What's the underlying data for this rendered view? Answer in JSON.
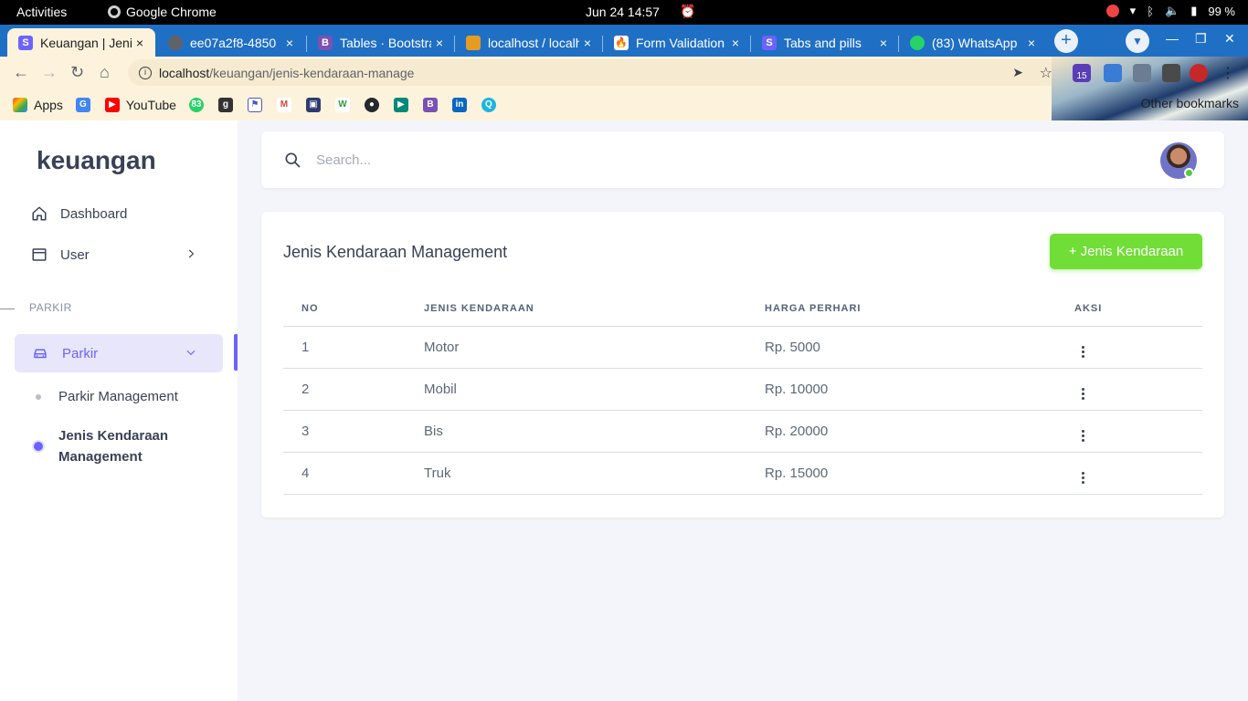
{
  "system": {
    "activities": "Activities",
    "app_name": "Google Chrome",
    "clock": "Jun 24  14:57",
    "battery": "99 %"
  },
  "browser": {
    "tabs": [
      {
        "title": "Keuangan | Jenis",
        "favicon_color": "#6c63ff",
        "close": "×"
      },
      {
        "title": "ee07a2f8-4850",
        "favicon_color": "#5f6368",
        "close": "×"
      },
      {
        "title": "Tables · Bootstrap",
        "favicon_color": "#7952b3",
        "close": "×"
      },
      {
        "title": "localhost / localhost",
        "favicon_color": "#e69b23",
        "close": "×"
      },
      {
        "title": "Form Validation",
        "favicon_color": "#e8542c",
        "close": "×"
      },
      {
        "title": "Tabs and pills",
        "favicon_color": "#6c63ff",
        "close": "×"
      },
      {
        "title": "(83) WhatsApp",
        "favicon_color": "#25d366",
        "close": "×"
      }
    ],
    "url_host": "localhost",
    "url_path": "/keuangan/jenis-kendaraan-manage",
    "bookmarks": [
      {
        "label": "Apps",
        "icon": "apps-grid-icon",
        "color": "#ea4335"
      },
      {
        "label": "",
        "icon": "translate-icon",
        "color": "#4285f4"
      },
      {
        "label": "YouTube",
        "icon": "youtube-icon",
        "color": "#ff0000"
      },
      {
        "label": "",
        "icon": "whatsapp-icon",
        "color": "#25d366"
      },
      {
        "label": "",
        "icon": "g-icon",
        "color": "#333333"
      },
      {
        "label": "",
        "icon": "flag-icon",
        "color": "#4a56c8"
      },
      {
        "label": "",
        "icon": "gmail-icon",
        "color": "#d44638"
      },
      {
        "label": "",
        "icon": "train-icon",
        "color": "#2f3b6e"
      },
      {
        "label": "",
        "icon": "w-icon",
        "color": "#2a9d3c"
      },
      {
        "label": "",
        "icon": "github-icon",
        "color": "#24292e"
      },
      {
        "label": "",
        "icon": "meet-icon",
        "color": "#00897b"
      },
      {
        "label": "",
        "icon": "bootstrap-icon",
        "color": "#7952b3"
      },
      {
        "label": "",
        "icon": "linkedin-icon",
        "color": "#0a66c2"
      },
      {
        "label": "",
        "icon": "search-bubble-icon",
        "color": "#1cb5e0"
      }
    ],
    "other_bookmarks": "Other bookmarks",
    "extension_badge": "15"
  },
  "sidebar": {
    "brand": "keuangan",
    "items": [
      {
        "label": "Dashboard"
      },
      {
        "label": "User"
      }
    ],
    "section": "PARKIR",
    "parkir": {
      "label": "Parkir",
      "submenu": [
        {
          "label": "Parkir Management"
        },
        {
          "label": "Jenis Kendaraan Management"
        }
      ]
    }
  },
  "search": {
    "placeholder": "Search..."
  },
  "main": {
    "title": "Jenis Kendaraan Management",
    "add_button": "+ Jenis Kendaraan",
    "columns": [
      "NO",
      "JENIS KENDARAAN",
      "HARGA PERHARI",
      "AKSI"
    ],
    "rows": [
      {
        "no": "1",
        "jenis": "Motor",
        "harga": "Rp. 5000"
      },
      {
        "no": "2",
        "jenis": "Mobil",
        "harga": "Rp. 10000"
      },
      {
        "no": "3",
        "jenis": "Bis",
        "harga": "Rp. 20000"
      },
      {
        "no": "4",
        "jenis": "Truk",
        "harga": "Rp. 15000"
      }
    ]
  },
  "colors": {
    "accent": "#6c63ff",
    "success": "#71dd37",
    "tabstrip": "#1f6fc5"
  }
}
